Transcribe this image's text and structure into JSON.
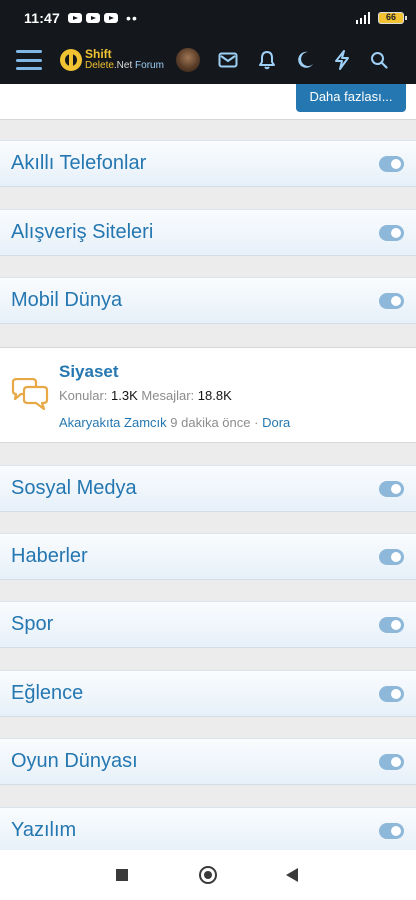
{
  "status_bar": {
    "time": "11:47",
    "dots": "••",
    "battery_level": "66",
    "icons": [
      "youtube-icon",
      "youtube-icon",
      "youtube-icon",
      "signal-icon",
      "battery-icon"
    ]
  },
  "header": {
    "logo": {
      "top": "Shift",
      "bottom_main": "Delete",
      "bottom_net": ".Net",
      "bottom_forum": "Forum"
    },
    "icons": [
      "menu-icon",
      "avatar",
      "mail-icon",
      "bell-icon",
      "moon-icon",
      "bolt-icon",
      "search-icon"
    ]
  },
  "more_button": "Daha fazlası...",
  "categories": [
    {
      "title": "Akıllı Telefonlar"
    },
    {
      "title": "Alışveriş Siteleri"
    },
    {
      "title": "Mobil Dünya"
    },
    {
      "title": "Sosyal Medya"
    },
    {
      "title": "Haberler"
    },
    {
      "title": "Spor"
    },
    {
      "title": "Eğlence"
    },
    {
      "title": "Oyun Dünyası"
    },
    {
      "title": "Yazılım"
    }
  ],
  "node": {
    "title": "Siyaset",
    "threads_label": "Konular:",
    "threads_value": "1.3K",
    "messages_label": "Mesajlar:",
    "messages_value": "18.8K",
    "latest_thread": "Akaryakıta Zamcık",
    "latest_time": "9 dakika önce",
    "separator": "·",
    "latest_user": "Dora"
  },
  "colors": {
    "accent": "#2577b1",
    "header_bg": "#14171c",
    "logo_yellow": "#f1c232",
    "toggle": "#8db8d9"
  }
}
